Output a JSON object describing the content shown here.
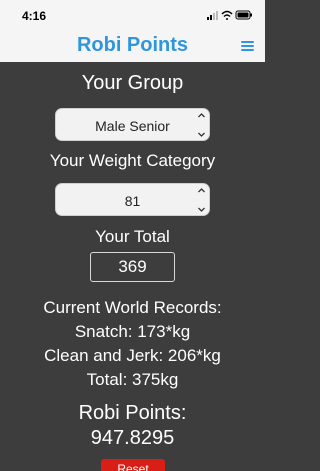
{
  "status": {
    "time": "4:16"
  },
  "nav": {
    "title": "Robi Points",
    "menu_icon": "hamburger-menu-icon"
  },
  "group": {
    "heading": "Your Group",
    "selected": "Male Senior"
  },
  "weight": {
    "heading": "Your Weight Category",
    "selected": "81"
  },
  "total": {
    "heading": "Your Total",
    "value": "369"
  },
  "records": {
    "heading": "Current World Records:",
    "snatch": "Snatch: 173*kg",
    "clean_jerk": "Clean and Jerk: 206*kg",
    "total": "Total: 375kg"
  },
  "result": {
    "heading": "Robi Points:",
    "value": "947.8295"
  },
  "reset": {
    "label": "Reset"
  },
  "colors": {
    "accent": "#2f96dd",
    "background": "#3d3d3d",
    "reset": "#d91e18"
  }
}
